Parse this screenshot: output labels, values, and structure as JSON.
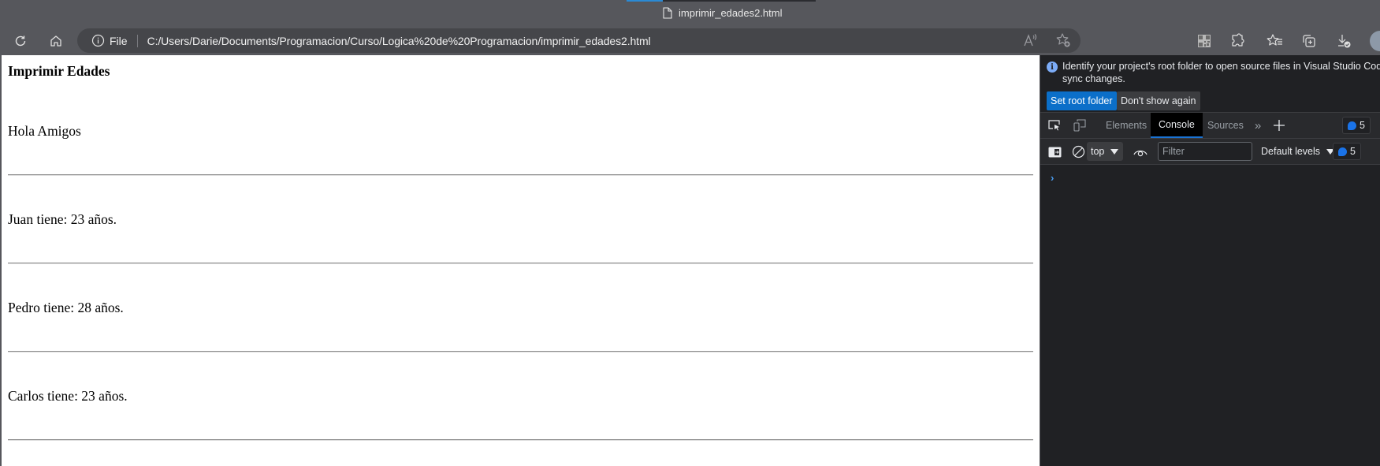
{
  "browser": {
    "tab": {
      "title": "imprimir_edades2.html",
      "icon": "file-icon"
    },
    "toolbar": {
      "reload_icon": "reload-icon",
      "home_icon": "home-icon",
      "address": {
        "security_icon": "info-icon",
        "scheme_label": "File",
        "url": "C:/Users/Darie/Documents/Programacion/Curso/Logica%20de%20Programacion/imprimir_edades2.html"
      },
      "address_icons": [
        "read-aloud-icon",
        "add-favorite-icon"
      ],
      "right_icons": [
        "qr-code-icon",
        "extensions-icon",
        "favorites-icon",
        "collections-icon",
        "downloads-icon",
        "profile-avatar"
      ]
    }
  },
  "page": {
    "heading": "Imprimir Edades",
    "lines": [
      "Hola Amigos",
      "Juan tiene: 23 años.",
      "Pedro tiene: 28 años.",
      "Carlos tiene: 23 años."
    ]
  },
  "devtools": {
    "infobar": {
      "message_line1": "Identify your project's root folder to open source files in Visual Studio Code and",
      "message_line2": "sync changes.",
      "primary_button": "Set root folder",
      "secondary_button": "Don't show again"
    },
    "tabs": [
      {
        "label": "Elements",
        "active": false
      },
      {
        "label": "Console",
        "active": true
      },
      {
        "label": "Sources",
        "active": false
      }
    ],
    "issues_count": "5",
    "console_toolbar": {
      "context": "top",
      "filter_placeholder": "Filter",
      "levels": "Default levels",
      "issues_count": "5"
    },
    "prompt_symbol": "›",
    "accent_color": "#1a73e8"
  }
}
